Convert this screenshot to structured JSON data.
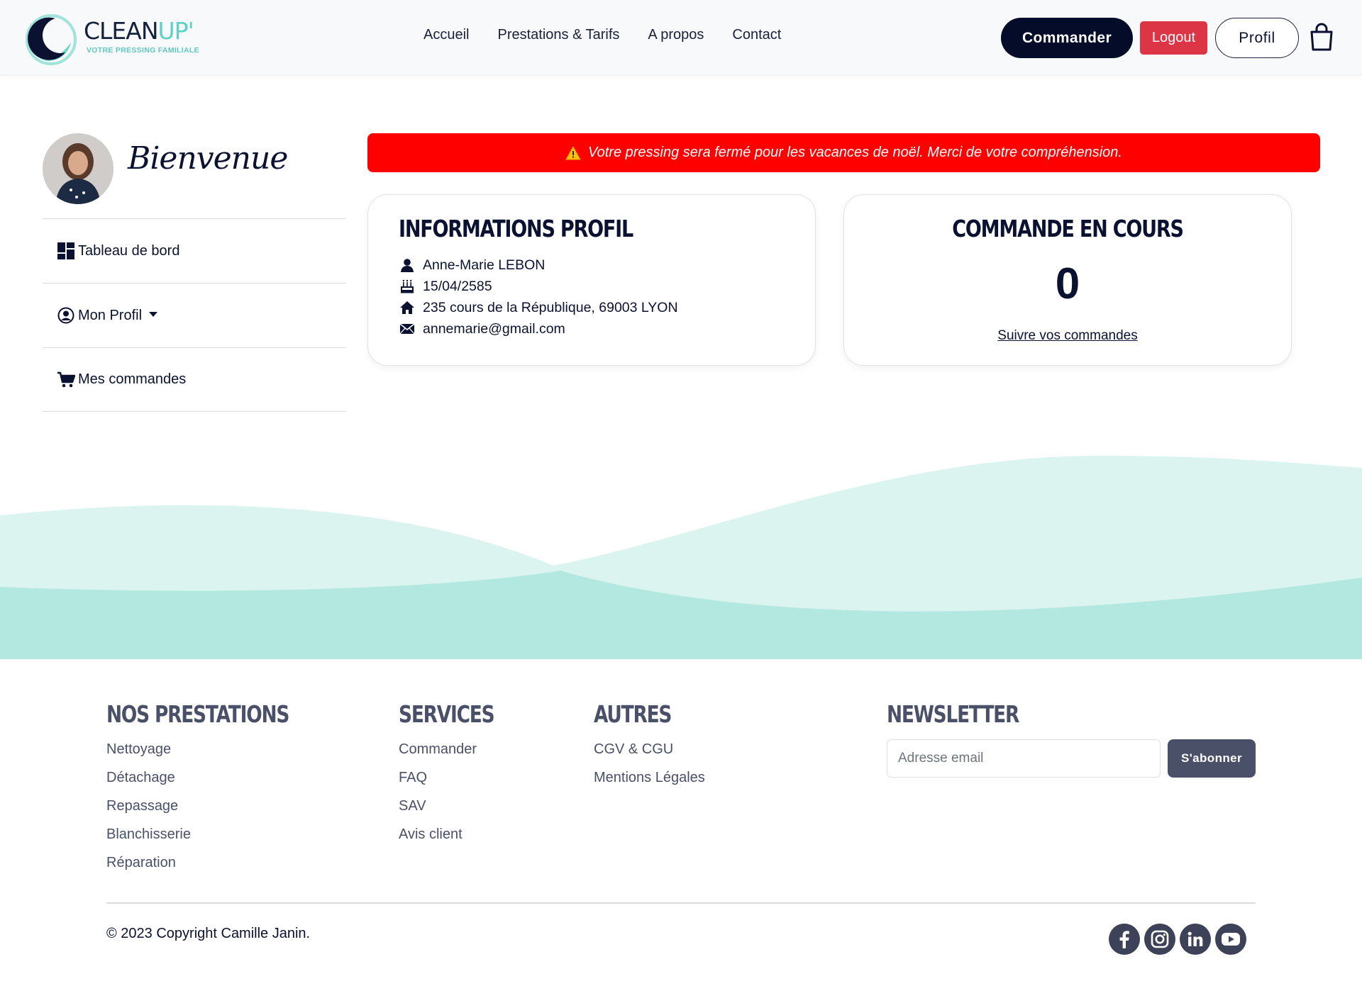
{
  "header": {
    "logo": {
      "brand_main": "CLEAN",
      "brand_accent": "UP'",
      "tagline": "VOTRE PRESSING FAMILIALE"
    },
    "nav": [
      {
        "label": "Accueil"
      },
      {
        "label": "Prestations & Tarifs"
      },
      {
        "label": "A propos"
      },
      {
        "label": "Contact"
      }
    ],
    "commander_label": "Commander",
    "logout_label": "Logout",
    "profil_label": "Profil",
    "cart_icon": "shopping-bag-icon"
  },
  "sidebar": {
    "welcome": "Bienvenue",
    "items": [
      {
        "label": "Tableau de bord",
        "icon": "dashboard-icon"
      },
      {
        "label": "Mon Profil",
        "icon": "user-circle-icon"
      },
      {
        "label": "Mes commandes",
        "icon": "cart-icon"
      }
    ]
  },
  "alert": {
    "icon": "warning-icon",
    "message": "Votre pressing sera fermé pour les vacances de noël. Merci de votre compréhension."
  },
  "profile_card": {
    "title": "INFORMATIONS PROFIL",
    "name": "Anne-Marie LEBON",
    "birthdate": "15/04/2585",
    "address": "235 cours de la République, 69003 LYON",
    "email": "annemarie@gmail.com"
  },
  "orders_card": {
    "title": "COMMANDE EN COURS",
    "count": "0",
    "link": "Suivre vos commandes"
  },
  "footer": {
    "prestations": {
      "title": "NOS PRESTATIONS",
      "links": [
        "Nettoyage",
        "Détachage",
        "Repassage",
        "Blanchisserie",
        "Réparation"
      ]
    },
    "services": {
      "title": "SERVICES",
      "links": [
        "Commander",
        "FAQ",
        "SAV",
        "Avis client"
      ]
    },
    "autres": {
      "title": "AUTRES",
      "links": [
        "CGV & CGU",
        "Mentions Légales"
      ]
    },
    "newsletter": {
      "title": "NEWSLETTER",
      "placeholder": "Adresse email",
      "button": "S'abonner"
    },
    "copyright": "© 2023 Copyright Camille Janin.",
    "socials": [
      "facebook-icon",
      "instagram-icon",
      "linkedin-icon",
      "youtube-icon"
    ]
  },
  "colors": {
    "navy": "#050c29",
    "danger": "#dc3545",
    "alert_red": "#ff0000",
    "mint_light": "#dcf4ef",
    "mint": "#b2e8df",
    "footer_text": "#4a5068"
  }
}
